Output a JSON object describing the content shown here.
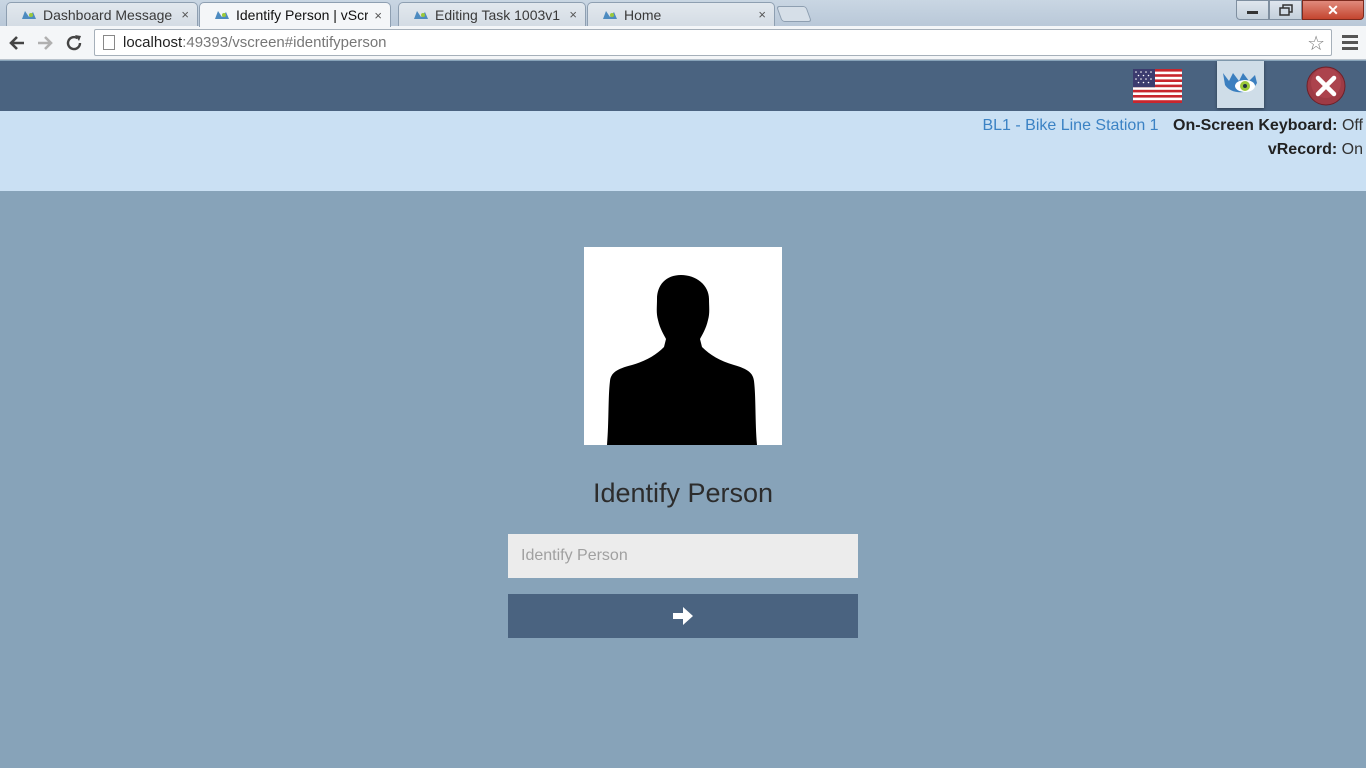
{
  "browser": {
    "tabs": [
      {
        "label": "Dashboard Message",
        "close": "×",
        "active": false
      },
      {
        "label": "Identify Person | vScr",
        "close": "×",
        "active": true
      },
      {
        "label": "Editing Task 1003v1",
        "close": "×",
        "active": false
      },
      {
        "label": "Home",
        "close": "×",
        "active": false
      }
    ],
    "window_controls": {
      "close": "✕"
    },
    "address": {
      "host": "localhost",
      "path": ":49393/vscreen#identifyperson"
    },
    "icons": [
      "back-arrow-icon",
      "forward-arrow-icon",
      "reload-icon",
      "page-icon",
      "bookmark-star-icon",
      "menu-icon"
    ]
  },
  "header": {
    "icons": [
      "us-flag-icon",
      "brand-eye-icon",
      "exit-icon"
    ],
    "colors": {
      "bar": "#4a6380",
      "exit": "#9e3b45"
    }
  },
  "info": {
    "station": "BL1 - Bike Line Station 1",
    "keyboard_label": "On-Screen Keyboard:",
    "keyboard_value": "Off",
    "vrecord_label": "vRecord:",
    "vrecord_value": "On"
  },
  "main": {
    "title": "Identify Person",
    "input_placeholder": "Identify Person",
    "input_value": "",
    "submit_icon": "arrow-right-icon",
    "colors": {
      "background": "#87a3b9",
      "info_bar": "#cae0f3",
      "button": "#4a6380"
    }
  }
}
